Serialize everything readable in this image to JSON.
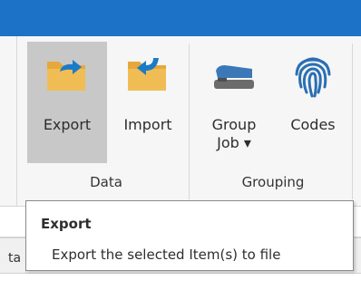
{
  "ribbon": {
    "groups": [
      {
        "label": "Data",
        "buttons": [
          {
            "label": "Export",
            "icon": "export-icon",
            "active": true
          },
          {
            "label": "Import",
            "icon": "import-icon",
            "active": false
          }
        ]
      },
      {
        "label": "Grouping",
        "buttons": [
          {
            "label_line1": "Group",
            "label_line2": "Job ▾",
            "icon": "stapler-icon",
            "active": false
          },
          {
            "label": "Codes",
            "icon": "fingerprint-icon",
            "active": false
          }
        ]
      }
    ]
  },
  "grid": {
    "partial_header": "ta"
  },
  "tooltip": {
    "title": "Export",
    "description": "Export the selected Item(s) to file"
  },
  "colors": {
    "titlebar": "#1b72c6",
    "folder": "#e6a83a",
    "arrow": "#1b7bc8",
    "stapler_blue": "#3a78b8",
    "stapler_gray": "#6b6b6b",
    "fingerprint": "#2a6fb3",
    "active_button": "#c8c8c8"
  }
}
